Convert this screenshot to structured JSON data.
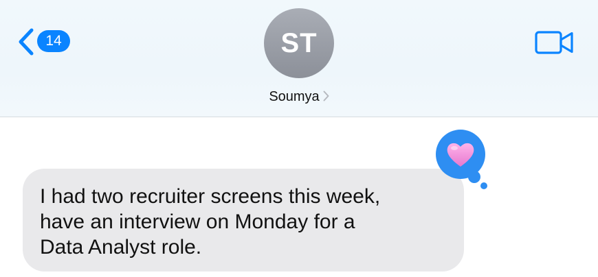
{
  "header": {
    "back_badge_count": "14",
    "avatar_initials": "ST",
    "contact_name": "Soumya",
    "accent_color": "#0a84ff"
  },
  "icons": {
    "back": "chevron-left-icon",
    "contact_disclosure": "chevron-right-icon",
    "video": "video-camera-icon",
    "reaction": "heart-icon"
  },
  "messages": [
    {
      "direction": "incoming",
      "lines": [
        "I had two recruiter screens this week,",
        "have an interview on Monday for a",
        "Data Analyst role."
      ],
      "reaction": "heart",
      "reaction_color": "#f48fd8"
    }
  ]
}
